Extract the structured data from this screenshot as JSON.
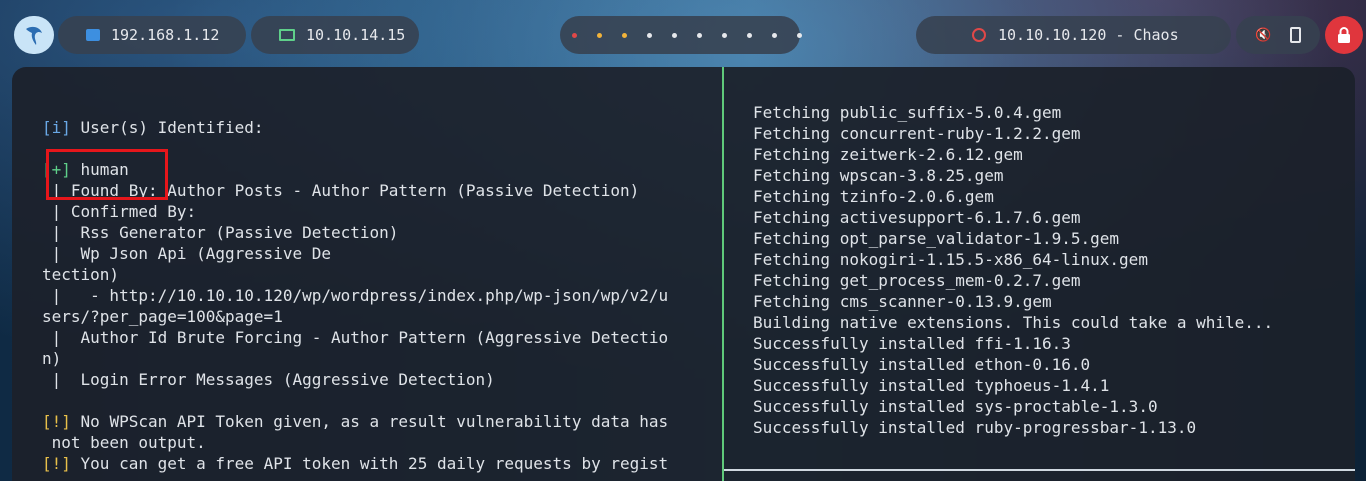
{
  "topbar": {
    "ip_local": "192.168.1.12",
    "ip_vpn": "10.10.14.15",
    "target": "10.10.10.120 - Chaos",
    "workspace_dots": [
      {
        "color": "#e04848"
      },
      {
        "color": "#f2b33a"
      },
      {
        "color": "#f2b33a"
      },
      {
        "color": "#e6e8ec"
      },
      {
        "color": "#e6e8ec"
      },
      {
        "color": "#e6e8ec"
      },
      {
        "color": "#e6e8ec"
      },
      {
        "color": "#e6e8ec"
      },
      {
        "color": "#e6e8ec"
      },
      {
        "color": "#e6e8ec"
      }
    ],
    "icons": {
      "logo": "kali-dragon-icon",
      "network": "network-icon",
      "vpn": "laptop-icon",
      "target": "target-icon",
      "sound": "mute-icon",
      "battery": "battery-icon",
      "lock": "lock-icon"
    }
  },
  "left_terminal": {
    "lines": [
      "",
      "[i] User(s) Identified:",
      "",
      "[+] human",
      " | Found By: Author Posts - Author Pattern (Passive Detection)",
      " | Confirmed By:",
      " |  Rss Generator (Passive Detection)",
      " |  Wp Json Api (Aggressive De",
      "tection)",
      " |   - http://10.10.10.120/wp/wordpress/index.php/wp-json/wp/v2/u",
      "sers/?per_page=100&page=1",
      " |  Author Id Brute Forcing - Author Pattern (Aggressive Detectio",
      "n)",
      " |  Login Error Messages (Aggressive Detection)",
      "",
      "[!] No WPScan API Token given, as a result vulnerability data has",
      " not been output.",
      "[!] You can get a free API token with 25 daily requests by regist"
    ]
  },
  "right_terminal": {
    "lines": [
      "Fetching public_suffix-5.0.4.gem",
      "Fetching concurrent-ruby-1.2.2.gem",
      "Fetching zeitwerk-2.6.12.gem",
      "Fetching wpscan-3.8.25.gem",
      "Fetching tzinfo-2.0.6.gem",
      "Fetching activesupport-6.1.7.6.gem",
      "Fetching opt_parse_validator-1.9.5.gem",
      "Fetching nokogiri-1.15.5-x86_64-linux.gem",
      "Fetching get_process_mem-0.2.7.gem",
      "Fetching cms_scanner-0.13.9.gem",
      "Building native extensions. This could take a while...",
      "Successfully installed ffi-1.16.3",
      "Successfully installed ethon-0.16.0",
      "Successfully installed typhoeus-1.4.1",
      "Successfully installed sys-proctable-1.3.0",
      "Successfully installed ruby-progressbar-1.13.0"
    ]
  },
  "colors": {
    "info": "#6aa8e6",
    "plus": "#5fd08a",
    "warn": "#e8c04a",
    "highlight": "#e6161b"
  }
}
